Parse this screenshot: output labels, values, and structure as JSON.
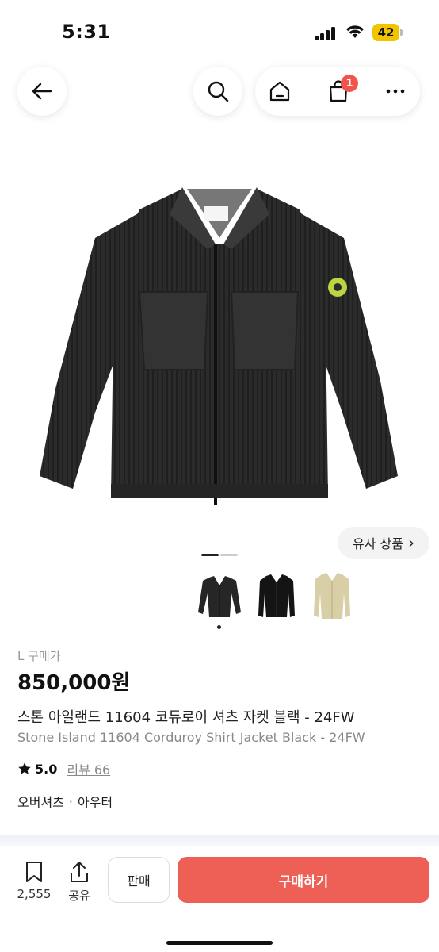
{
  "status_bar": {
    "time": "5:31",
    "battery": "42"
  },
  "nav": {
    "cart_badge": "1"
  },
  "similar": {
    "label": "유사 상품",
    "chevron": "›"
  },
  "thumbnails": [
    {
      "name": "black corduroy jacket",
      "color": "#262626"
    },
    {
      "name": "black knit jacket",
      "color": "#141414"
    },
    {
      "name": "beige overshirt",
      "color": "#d9cfa6"
    }
  ],
  "product": {
    "size_label": "L 구매가",
    "price": "850,000원",
    "title_ko": "스톤 아일랜드 11604 코듀로이 셔츠 자켓 블랙 - 24FW",
    "title_en": "Stone Island 11604 Corduroy Shirt Jacket Black - 24FW",
    "rating": "5.0",
    "review_link": "리뷰 66",
    "categories": [
      "오버셔츠",
      "아우터"
    ],
    "category_sep": "·"
  },
  "bottom_bar": {
    "bookmark_count": "2,555",
    "share_label": "공유",
    "sell_label": "판매",
    "buy_label": "구매하기"
  },
  "colors": {
    "accent": "#ee5f55",
    "badge": "#f0544a"
  }
}
